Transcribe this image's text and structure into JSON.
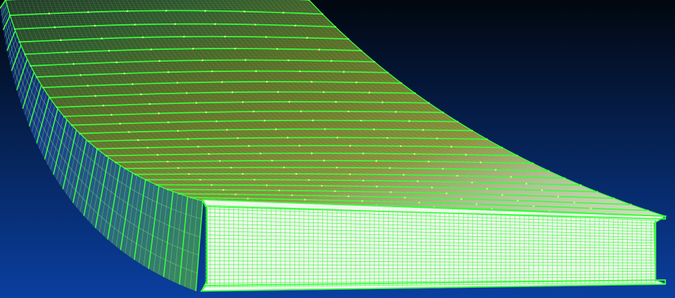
{
  "viewport": {
    "background_top": "#02070f",
    "background_bottom": "#0a3fa0"
  },
  "mesh": {
    "wire_color": "#39ff3c",
    "wire_color_dim": "#7dff6f",
    "node_color": "#c8ff8a",
    "surface_gradient": [
      "#1e3a28",
      "#2f5a2c",
      "#556b25",
      "#6f7a2a",
      "#8a8d3a",
      "#b5c29a",
      "#d8e4c8"
    ],
    "side_gradient": [
      "#0b1a5a",
      "#1a3c8a",
      "#2c6a7d",
      "#3e8f5a"
    ],
    "cap_fill": "#f2f6ee"
  }
}
